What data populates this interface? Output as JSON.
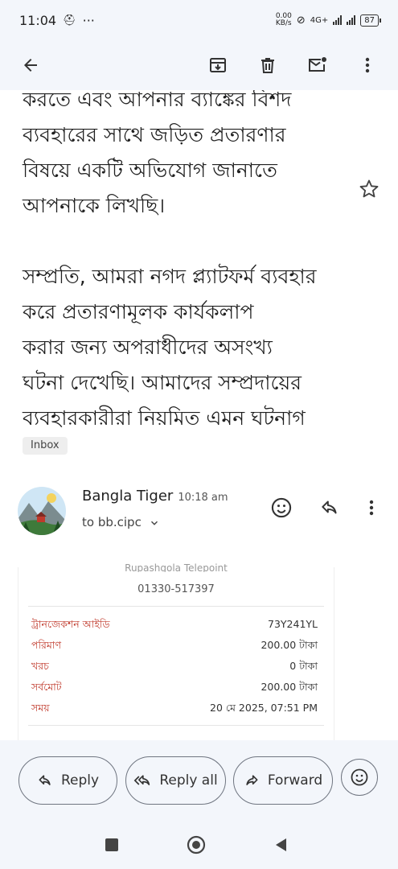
{
  "status_bar": {
    "time": "11:04",
    "notif_dots": "···",
    "net_speed_value": "0.00",
    "net_speed_unit": "KB/s",
    "network_type": "4G+",
    "battery": "87"
  },
  "toolbar": {
    "back_icon": "arrow-left-icon",
    "archive_icon": "archive-icon",
    "delete_icon": "trash-icon",
    "mark_unread_icon": "mail-unread-icon",
    "more_icon": "more-vert-icon"
  },
  "email_body": {
    "paragraph1_lines": [
      "করতে এবং আপনার ব্যাঙ্কের বিশদ",
      "ব্যবহারের সাথে জড়িত প্রতারণার",
      "বিষয়ে একটি অভিযোগ জানাতে",
      "আপনাকে লিখছি।"
    ],
    "paragraph2_lines": [
      "সম্প্রতি, আমরা নগদ প্ল্যাটফর্ম ব্যবহার",
      "করে প্রতারণামূলক কার্যকলাপ",
      "করার জন্য অপরাধীদের অসংখ্য",
      "ঘটনা দেখেছি। আমাদের সম্প্রদায়ের",
      "ব্যবহারকারীরা নিয়মিত এমন ঘটনাগ"
    ]
  },
  "label_chip": "Inbox",
  "message": {
    "sender_name": "Bangla Tiger",
    "time": "10:18 am",
    "recipient": "to bb.cipc"
  },
  "receipt": {
    "top_partial_text": "Rupashgola Telepoint",
    "phone": "01330-517397",
    "rows": [
      {
        "label": "ট্রানজেকশন আইডি",
        "value": "73Y241YL"
      },
      {
        "label": "পরিমাণ",
        "value": "200.00 টাকা"
      },
      {
        "label": "খরচ",
        "value": "0 টাকা"
      },
      {
        "label": "সর্বমোট",
        "value": "200.00 টাকা"
      },
      {
        "label": "সময়",
        "value": "20 মে 2025, 07:51 PM"
      }
    ]
  },
  "actions": {
    "reply": "Reply",
    "reply_all": "Reply all",
    "forward": "Forward"
  },
  "colors": {
    "chrome_bg": "#f3f6fb",
    "receipt_label": "#c0392b"
  }
}
